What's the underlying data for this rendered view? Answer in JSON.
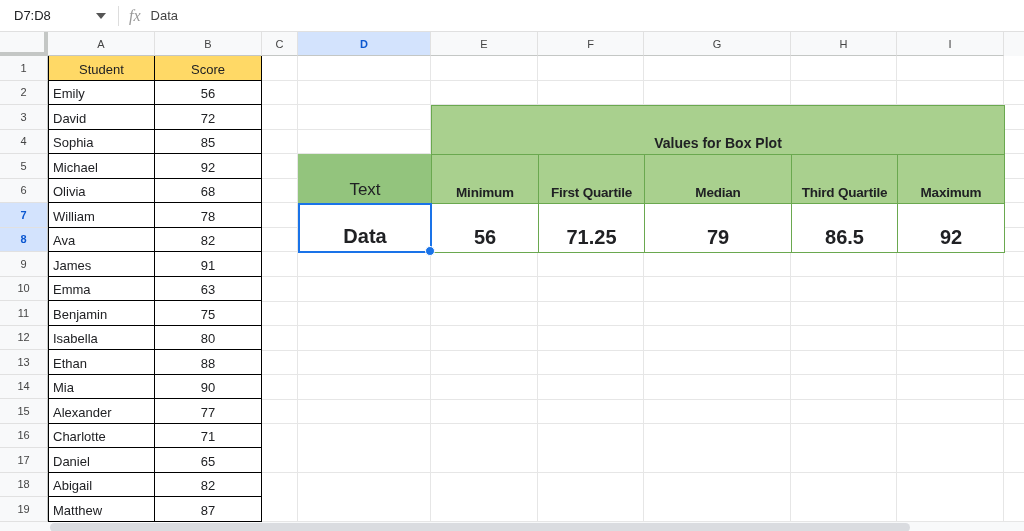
{
  "toolbar": {
    "name_box": "D7:D8",
    "formula_label": "fx",
    "formula": "Data"
  },
  "columns": [
    {
      "label": "A",
      "selected": false
    },
    {
      "label": "B",
      "selected": false
    },
    {
      "label": "C",
      "selected": false
    },
    {
      "label": "D",
      "selected": true
    },
    {
      "label": "E",
      "selected": false
    },
    {
      "label": "F",
      "selected": false
    },
    {
      "label": "G",
      "selected": false
    },
    {
      "label": "H",
      "selected": false
    },
    {
      "label": "I",
      "selected": false
    }
  ],
  "rows": [
    {
      "label": "1",
      "selected": false
    },
    {
      "label": "2",
      "selected": false
    },
    {
      "label": "3",
      "selected": false
    },
    {
      "label": "4",
      "selected": false
    },
    {
      "label": "5",
      "selected": false
    },
    {
      "label": "6",
      "selected": false
    },
    {
      "label": "7",
      "selected": true
    },
    {
      "label": "8",
      "selected": true
    },
    {
      "label": "9",
      "selected": false
    },
    {
      "label": "10",
      "selected": false
    },
    {
      "label": "11",
      "selected": false
    },
    {
      "label": "12",
      "selected": false
    },
    {
      "label": "13",
      "selected": false
    },
    {
      "label": "14",
      "selected": false
    },
    {
      "label": "15",
      "selected": false
    },
    {
      "label": "16",
      "selected": false
    },
    {
      "label": "17",
      "selected": false
    },
    {
      "label": "18",
      "selected": false
    },
    {
      "label": "19",
      "selected": false
    }
  ],
  "score_table": {
    "headers": [
      "Student",
      "Score"
    ],
    "rows": [
      [
        "Emily",
        "56"
      ],
      [
        "David",
        "72"
      ],
      [
        "Sophia",
        "85"
      ],
      [
        "Michael",
        "92"
      ],
      [
        "Olivia",
        "68"
      ],
      [
        "William",
        "78"
      ],
      [
        "Ava",
        "82"
      ],
      [
        "James",
        "91"
      ],
      [
        "Emma",
        "63"
      ],
      [
        "Benjamin",
        "75"
      ],
      [
        "Isabella",
        "80"
      ],
      [
        "Ethan",
        "88"
      ],
      [
        "Mia",
        "90"
      ],
      [
        "Alexander",
        "77"
      ],
      [
        "Charlotte",
        "71"
      ],
      [
        "Daniel",
        "65"
      ],
      [
        "Abigail",
        "82"
      ],
      [
        "Matthew",
        "87"
      ]
    ]
  },
  "box_plot_table": {
    "title": "Values for Box Plot",
    "row_label_header": "Text",
    "row_label": "Data",
    "selected": true,
    "stats": [
      {
        "name": "Minimum",
        "value": "56"
      },
      {
        "name": "First Quartile",
        "value": "71.25"
      },
      {
        "name": "Median",
        "value": "79"
      },
      {
        "name": "Third Quartile",
        "value": "86.5"
      },
      {
        "name": "Maximum",
        "value": "92"
      }
    ]
  }
}
